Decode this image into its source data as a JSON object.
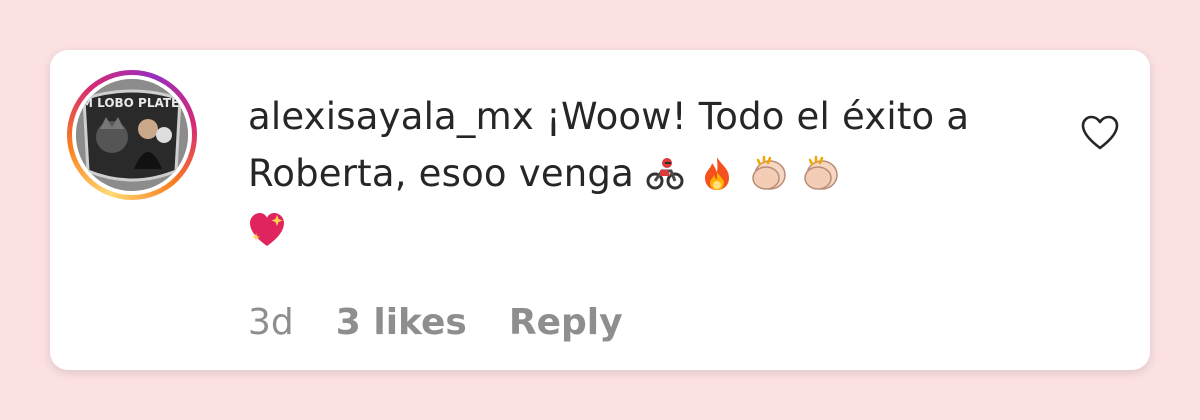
{
  "comment": {
    "username": "alexisayala_mx",
    "text": "¡Woow! Todo el éxito a Roberta, esoo venga",
    "emojis": [
      "racing-motorcycle-icon",
      "fire-icon",
      "clapping-hands-icon",
      "clapping-hands-icon",
      "sparkling-heart-icon"
    ],
    "avatar_text": "TEAM LOBO PLATEADO"
  },
  "meta": {
    "time": "3d",
    "likes": "3 likes",
    "reply": "Reply"
  },
  "colors": {
    "page_bg": "#fce1e3",
    "card_bg": "#ffffff",
    "text": "#262626",
    "muted": "#8e8e8e"
  }
}
